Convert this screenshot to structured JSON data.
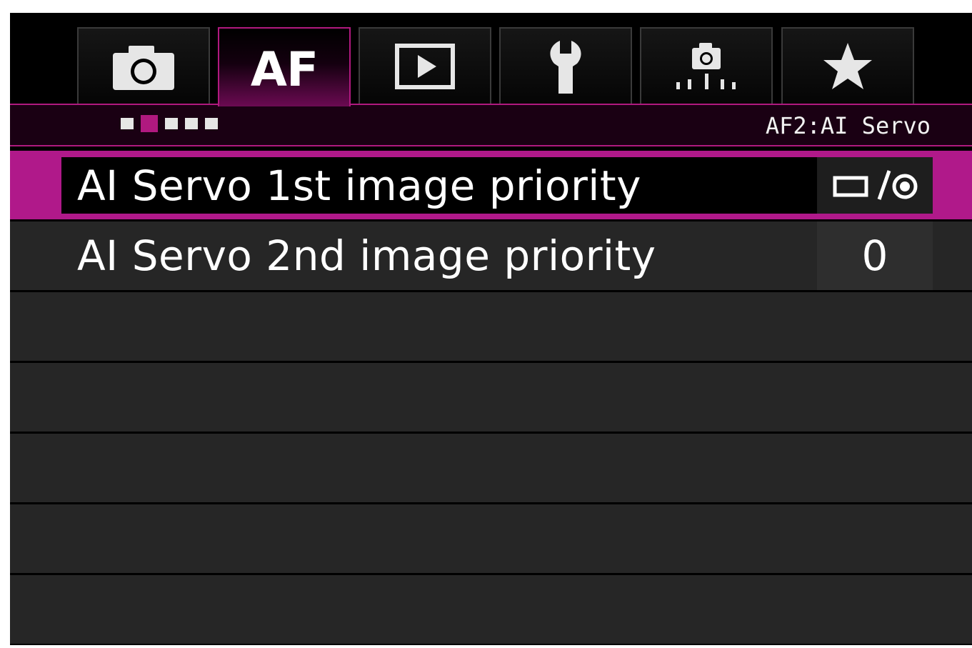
{
  "tabs": [
    {
      "icon": "camera-icon",
      "label": "",
      "active": false
    },
    {
      "icon": "",
      "label": "AF",
      "active": true
    },
    {
      "icon": "playback-icon",
      "label": "",
      "active": false
    },
    {
      "icon": "wrench-icon",
      "label": "",
      "active": false
    },
    {
      "icon": "custom-function-camera-icon",
      "label": "",
      "active": false
    },
    {
      "icon": "star-icon",
      "label": "",
      "active": false
    }
  ],
  "subheader": {
    "page_count": 5,
    "active_page": 2,
    "title": "AF2:AI Servo"
  },
  "menu": {
    "items": [
      {
        "label": "AI Servo 1st image priority",
        "value": "",
        "value_icon": "release-focus-priority-icon",
        "selected": true
      },
      {
        "label": "AI Servo 2nd image priority",
        "value": "0",
        "selected": false
      }
    ],
    "empty_rows": 5
  },
  "colors": {
    "accent": "#b0198a",
    "row_background": "#262626",
    "screen_background": "#000000"
  }
}
